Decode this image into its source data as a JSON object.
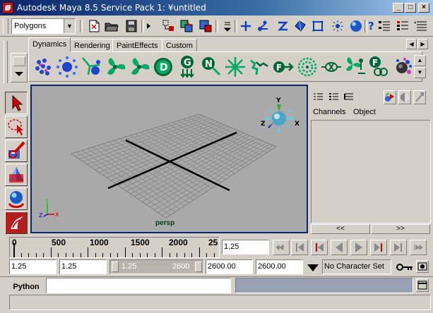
{
  "window": {
    "title": "Autodesk Maya 8.5 Service Pack 1: ¥untitled",
    "minimize": "_",
    "maximize": "□",
    "close": "×"
  },
  "status_line": {
    "mode_value": "Polygons",
    "icons": [
      "new-scene-icon",
      "open-scene-icon",
      "save-scene-icon",
      "select-hierarchy-icon",
      "select-object-icon",
      "select-component-icon",
      "snap-grid-icon",
      "snap-curve-icon",
      "snap-point-icon",
      "snap-plane-icon",
      "make-live-icon",
      "history-icon",
      "render-icon",
      "ipr-icon",
      "show-attribute-editor-icon",
      "show-tool-settings-icon",
      "show-channel-box-icon"
    ]
  },
  "shelf": {
    "tabs": [
      {
        "label": "Dynamics",
        "active": true
      },
      {
        "label": "Rendering",
        "active": false
      },
      {
        "label": "PaintEffects",
        "active": false
      },
      {
        "label": "Custom",
        "active": false
      }
    ],
    "buttons": [
      "particle-tool-icon",
      "emitter-icon",
      "omni-emitter-icon",
      "air-field-icon",
      "drag-field-icon",
      "gravity-field-icon",
      "newton-field-icon",
      "radial-field-icon",
      "turbulence-field-icon",
      "uniform-field-icon",
      "vortex-field-icon",
      "volume-axis-icon",
      "fluid-icon",
      "connect-field-icon",
      "collide-icon",
      "rigid-body-icon"
    ]
  },
  "toolbox": {
    "tools": [
      "select-tool",
      "lasso-tool",
      "paint-select-tool",
      "move-tool",
      "rotate-tool",
      "scale-tool"
    ]
  },
  "viewport": {
    "camera_label": "persp",
    "axis_y": "Y",
    "axis_x": "X",
    "axis_z": "Z"
  },
  "channel_box": {
    "menu_channels": "Channels",
    "menu_object": "Object",
    "scroll_left": "<<",
    "scroll_right": ">>"
  },
  "time_slider": {
    "ticks": [
      "0",
      "500",
      "1000",
      "1500",
      "2000",
      "25"
    ],
    "current_time": "1.25"
  },
  "range_slider": {
    "start_time": "1.25",
    "playback_start": "1.25",
    "range_left": "1.25",
    "range_right": "2600",
    "playback_end": "2600.00",
    "end_time": "2600.00",
    "character_set": "No Character Set"
  },
  "command_line": {
    "label": "Python",
    "value": ""
  },
  "colors": {
    "viewport_bg": "#a9a9a9",
    "grid_line": "#8c8c8c",
    "title_active": "#0a246a"
  }
}
